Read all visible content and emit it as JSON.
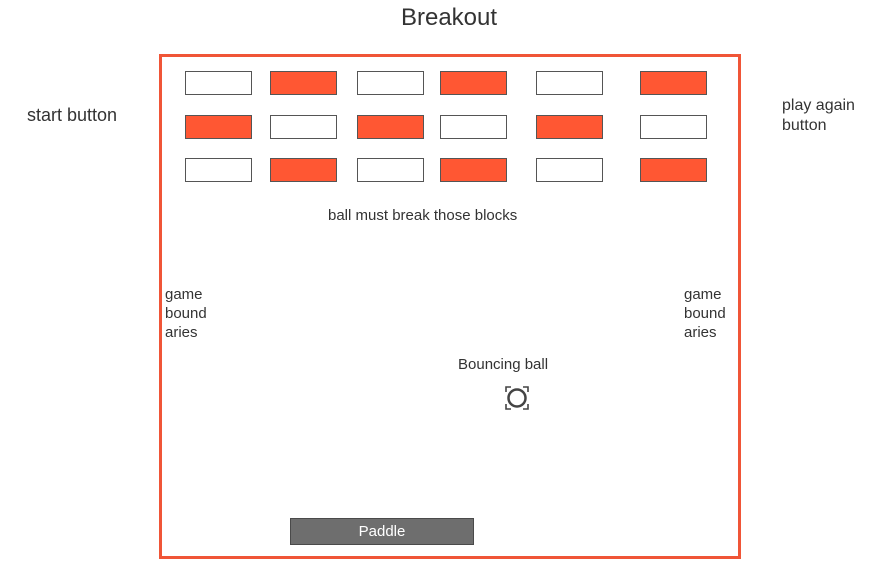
{
  "title": "Breakout",
  "start_label": "start button",
  "play_again_label": "play again\nbutton",
  "blocks_caption": "ball must break those blocks",
  "bound_left": "game\nbound\naries",
  "bound_right": "game\nbound\naries",
  "ball_caption": "Bouncing ball",
  "paddle_label": "Paddle",
  "colors": {
    "frame": "#f05537",
    "filled_block": "#ff5733",
    "empty_block": "#ffffff",
    "paddle": "#6e6e6e"
  },
  "blocks": [
    [
      "empty",
      "filled",
      "empty",
      "filled",
      "empty",
      "filled"
    ],
    [
      "filled",
      "empty",
      "filled",
      "empty",
      "filled",
      "empty"
    ],
    [
      "empty",
      "filled",
      "empty",
      "filled",
      "empty",
      "filled"
    ]
  ]
}
